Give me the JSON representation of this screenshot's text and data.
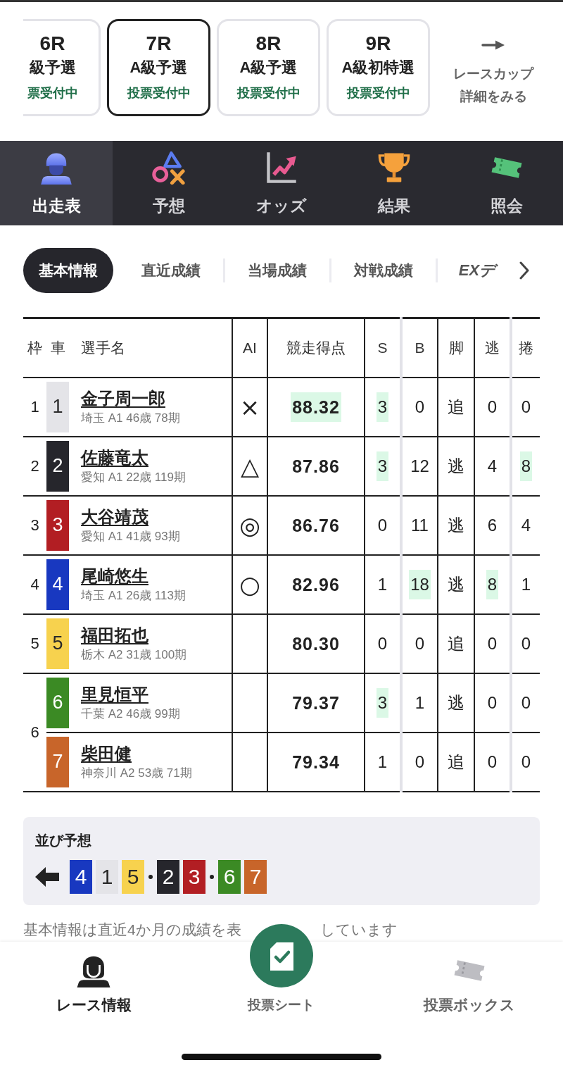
{
  "race_tabs": [
    {
      "race": "6R",
      "race_class": "級予選",
      "status": "票受付中",
      "selected": false,
      "cut_off": true
    },
    {
      "race": "7R",
      "race_class": "A級予選",
      "status": "投票受付中",
      "selected": true,
      "cut_off": false
    },
    {
      "race": "8R",
      "race_class": "A級予選",
      "status": "投票受付中",
      "selected": false,
      "cut_off": false
    },
    {
      "race": "9R",
      "race_class": "A級初特選",
      "status": "投票受付中",
      "selected": false,
      "cut_off": false
    }
  ],
  "race_cup_link": {
    "lines": [
      "レースカップ",
      "詳細をみる"
    ]
  },
  "main_nav": [
    {
      "label": "出走表",
      "kind": "entries",
      "selected": true
    },
    {
      "label": "予想",
      "kind": "forecast",
      "selected": false
    },
    {
      "label": "オッズ",
      "kind": "odds",
      "selected": false
    },
    {
      "label": "結果",
      "kind": "results",
      "selected": false
    },
    {
      "label": "照会",
      "kind": "inquiry",
      "selected": false
    }
  ],
  "sub_tabs": [
    {
      "label": "基本情報",
      "kind": "text",
      "selected": true
    },
    {
      "label": "直近成績",
      "kind": "text",
      "selected": false
    },
    {
      "label": "当場成績",
      "kind": "text",
      "selected": false
    },
    {
      "label": "対戦成績",
      "kind": "text",
      "selected": false
    },
    {
      "label": "EXデ",
      "kind": "logo",
      "selected": false
    }
  ],
  "table": {
    "columns": [
      "枠",
      "車",
      "選手名",
      "AI",
      "競走得点",
      "S",
      "B",
      "脚",
      "逃",
      "捲"
    ],
    "frames": [
      {
        "number": "1",
        "racers": [
          {
            "car": "1",
            "color": "#e4e4e8",
            "name": "金子周一郎",
            "profile": "埼玉 A1 46歳 78期",
            "ai_mark": "×",
            "score": {
              "value": "88.32",
              "highlight": true
            },
            "stats": [
              {
                "value": "3",
                "highlight": true
              },
              {
                "value": "0",
                "highlight": false
              },
              {
                "value": "追",
                "highlight": false
              },
              {
                "value": "0",
                "highlight": false
              },
              {
                "value": "0",
                "highlight": false
              }
            ]
          }
        ]
      },
      {
        "number": "2",
        "racers": [
          {
            "car": "2",
            "color": "#26262c",
            "name": "佐藤竜太",
            "profile": "愛知 A1 22歳 119期",
            "ai_mark": "△",
            "score": {
              "value": "87.86",
              "highlight": false
            },
            "stats": [
              {
                "value": "3",
                "highlight": true
              },
              {
                "value": "12",
                "highlight": false
              },
              {
                "value": "逃",
                "highlight": false
              },
              {
                "value": "4",
                "highlight": false
              },
              {
                "value": "8",
                "highlight": true
              }
            ]
          }
        ]
      },
      {
        "number": "3",
        "racers": [
          {
            "car": "3",
            "color": "#b21e23",
            "name": "大谷靖茂",
            "profile": "愛知 A1 41歳 93期",
            "ai_mark": "◎",
            "score": {
              "value": "86.76",
              "highlight": false
            },
            "stats": [
              {
                "value": "0",
                "highlight": false
              },
              {
                "value": "11",
                "highlight": false
              },
              {
                "value": "逃",
                "highlight": false
              },
              {
                "value": "6",
                "highlight": false
              },
              {
                "value": "4",
                "highlight": false
              }
            ]
          }
        ]
      },
      {
        "number": "4",
        "racers": [
          {
            "car": "4",
            "color": "#1838c0",
            "name": "尾崎悠生",
            "profile": "埼玉 A1 26歳 113期",
            "ai_mark": "○",
            "score": {
              "value": "82.96",
              "highlight": false
            },
            "stats": [
              {
                "value": "1",
                "highlight": false
              },
              {
                "value": "18",
                "highlight": true
              },
              {
                "value": "逃",
                "highlight": false
              },
              {
                "value": "8",
                "highlight": true
              },
              {
                "value": "1",
                "highlight": false
              }
            ]
          }
        ]
      },
      {
        "number": "5",
        "racers": [
          {
            "car": "5",
            "color": "#f7d24e",
            "name": "福田拓也",
            "profile": "栃木 A2 31歳 100期",
            "score": {
              "value": "80.30",
              "highlight": false
            },
            "stats": [
              {
                "value": "0",
                "highlight": false
              },
              {
                "value": "0",
                "highlight": false
              },
              {
                "value": "追",
                "highlight": false
              },
              {
                "value": "0",
                "highlight": false
              },
              {
                "value": "0",
                "highlight": false
              }
            ]
          }
        ]
      },
      {
        "number": "6",
        "racers": [
          {
            "car": "6",
            "color": "#3b8a24",
            "name": "里見恒平",
            "profile": "千葉 A2 46歳 99期",
            "score": {
              "value": "79.37",
              "highlight": false
            },
            "stats": [
              {
                "value": "3",
                "highlight": true
              },
              {
                "value": "1",
                "highlight": false
              },
              {
                "value": "逃",
                "highlight": false
              },
              {
                "value": "0",
                "highlight": false
              },
              {
                "value": "0",
                "highlight": false
              }
            ]
          },
          {
            "car": "7",
            "color": "#c8652a",
            "name": "柴田健",
            "profile": "神奈川 A2 53歳 71期",
            "score": {
              "value": "79.34",
              "highlight": false
            },
            "stats": [
              {
                "value": "1",
                "highlight": false
              },
              {
                "value": "0",
                "highlight": false
              },
              {
                "value": "追",
                "highlight": false
              },
              {
                "value": "0",
                "highlight": false
              },
              {
                "value": "0",
                "highlight": false
              }
            ]
          }
        ]
      }
    ]
  },
  "line_prediction": {
    "title": "並び予想",
    "groups": [
      [
        {
          "number": "4",
          "color": "#1838c0"
        },
        {
          "number": "1",
          "color": "#e4e4e8"
        },
        {
          "number": "5",
          "color": "#f7d24e"
        }
      ],
      [
        {
          "number": "2",
          "color": "#26262c"
        },
        {
          "number": "3",
          "color": "#b21e23"
        }
      ],
      [
        {
          "number": "6",
          "color": "#3b8a24"
        },
        {
          "number": "7",
          "color": "#c8652a"
        }
      ]
    ]
  },
  "footnote": {
    "parts": [
      "基本情報は直近4か月の成績を表",
      "しています"
    ]
  },
  "bottom_nav": [
    {
      "label": "レース情報",
      "kind": "race",
      "selected": true
    },
    {
      "label": "投票シート",
      "kind": "sheet",
      "selected": false
    },
    {
      "label": "投票ボックス",
      "kind": "box",
      "selected": false
    }
  ]
}
